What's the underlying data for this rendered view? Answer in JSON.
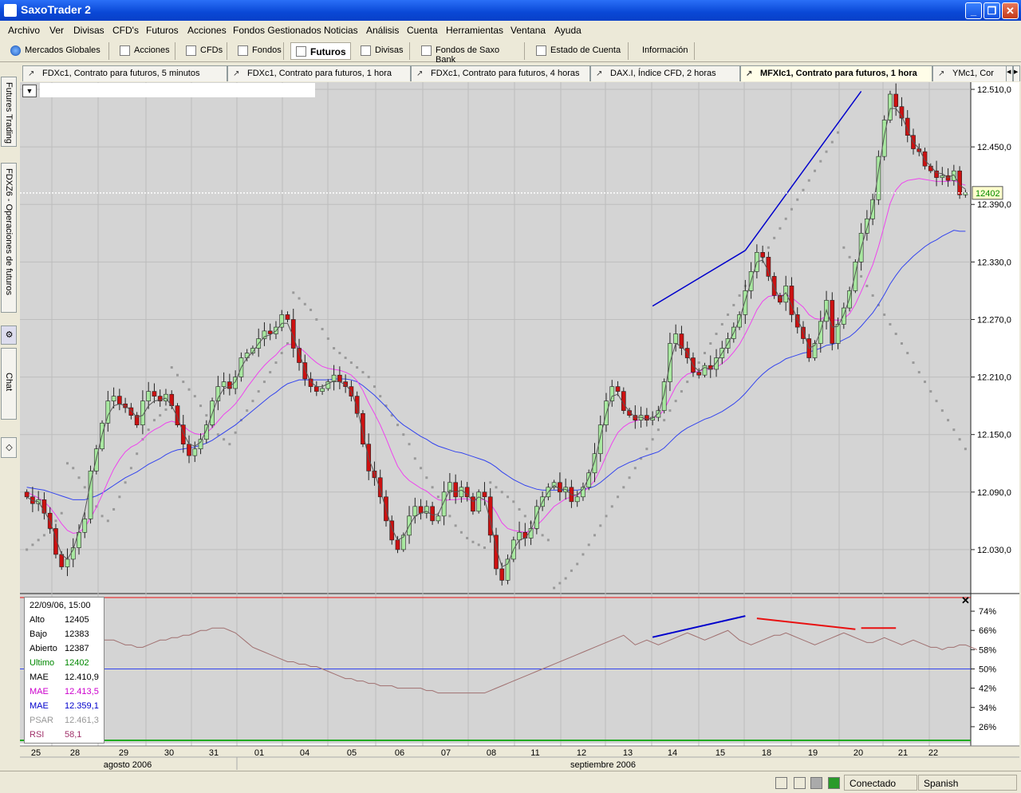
{
  "window": {
    "title": "SaxoTrader 2"
  },
  "menu": [
    "Archivo",
    "Ver",
    "Divisas",
    "CFD's",
    "Futuros",
    "Acciones",
    "Fondos Gestionados",
    "Noticias",
    "Análisis",
    "Cuenta",
    "Herramientas",
    "Ventana",
    "Ayuda"
  ],
  "toolbar": [
    {
      "label": "Mercados Globales",
      "icon": "globe-icon"
    },
    {
      "label": "Acciones",
      "icon": "stocks-icon"
    },
    {
      "label": "CFDs",
      "icon": "cfd-icon"
    },
    {
      "label": "Fondos",
      "icon": "funds-icon"
    },
    {
      "label": "Futuros",
      "icon": "futures-icon",
      "active": true
    },
    {
      "label": "Divisas",
      "icon": "fx-icon"
    },
    {
      "label": "Fondos de Saxo Bank",
      "icon": "saxo-funds-icon"
    },
    {
      "label": "Estado de Cuenta",
      "icon": "account-icon"
    },
    {
      "label": "Información",
      "icon": ""
    }
  ],
  "chart_tabs": [
    {
      "label": "FDXc1, Contrato para futuros, 5 minutos"
    },
    {
      "label": "FDXc1, Contrato para futuros, 1 hora"
    },
    {
      "label": "FDXc1, Contrato para futuros, 4 horas"
    },
    {
      "label": "DAX.I, Índice CFD, 2 horas"
    },
    {
      "label": "MFXIc1, Contrato para futuros, 1 hora",
      "active": true
    },
    {
      "label": "YMc1, Cor"
    }
  ],
  "side_tabs": [
    "Futures Trading",
    "FDXZ6 - Operaciones de futuros",
    "Chat"
  ],
  "colors": {
    "bull": "#a8e8a0",
    "bear": "#cc1111",
    "mae_fast": "#555555",
    "mae_mid": "#ee44ee",
    "mae_slow": "#3344ee",
    "psar": "#999999",
    "rsi": "#a07070",
    "trend": "#0000cc"
  },
  "chart_data": {
    "type": "candlestick",
    "price_axis": {
      "ticks": [
        "12.510,0",
        "12.450,0",
        "12.390,0",
        "12.330,0",
        "12.270,0",
        "12.210,0",
        "12.150,0",
        "12.090,0",
        "12.030,0"
      ],
      "ylim": [
        11985,
        12515
      ]
    },
    "current_price": "12402",
    "x_labels": [
      "25",
      "28",
      "29",
      "30",
      "31",
      "01",
      "04",
      "05",
      "06",
      "07",
      "08",
      "11",
      "12",
      "13",
      "14",
      "15",
      "18",
      "19",
      "20",
      "21",
      "22"
    ],
    "month_labels": [
      "agosto 2006",
      "septiembre 2006"
    ],
    "rsi_axis": {
      "ticks": [
        "74%",
        "66%",
        "58%",
        "50%",
        "42%",
        "34%",
        "26%"
      ],
      "ylim": [
        20,
        80
      ]
    },
    "closes": [
      12085,
      12078,
      12082,
      12068,
      12052,
      12025,
      12012,
      12020,
      12032,
      12048,
      12062,
      12112,
      12135,
      12162,
      12185,
      12190,
      12182,
      12178,
      12170,
      12160,
      12185,
      12195,
      12190,
      12185,
      12192,
      12180,
      12160,
      12140,
      12128,
      12135,
      12145,
      12160,
      12185,
      12200,
      12205,
      12198,
      12210,
      12230,
      12235,
      12240,
      12250,
      12258,
      12255,
      12262,
      12275,
      12270,
      12240,
      12225,
      12208,
      12200,
      12195,
      12198,
      12205,
      12212,
      12205,
      12200,
      12190,
      12172,
      12140,
      12112,
      12105,
      12085,
      12060,
      12040,
      12030,
      12045,
      12065,
      12075,
      12068,
      12075,
      12060,
      12065,
      12090,
      12100,
      12085,
      12095,
      12085,
      12070,
      12090,
      12085,
      12045,
      12010,
      11998,
      12020,
      12040,
      12048,
      12042,
      12052,
      12075,
      12085,
      12095,
      12100,
      12090,
      12095,
      12080,
      12085,
      12095,
      12110,
      12130,
      12160,
      12185,
      12200,
      12195,
      12175,
      12170,
      12165,
      12170,
      12165,
      12168,
      12175,
      12205,
      12245,
      12255,
      12240,
      12230,
      12215,
      12212,
      12222,
      12218,
      12230,
      12240,
      12250,
      12262,
      12275,
      12300,
      12320,
      12340,
      12335,
      12315,
      12295,
      12288,
      12305,
      12275,
      12262,
      12250,
      12230,
      12245,
      12268,
      12290,
      12245,
      12265,
      12282,
      12300,
      12330,
      12360,
      12375,
      12395,
      12440,
      12478,
      12505,
      12492,
      12480,
      12462,
      12448,
      12445,
      12430,
      12425,
      12418,
      12420,
      12415,
      12425,
      12400,
      12402
    ],
    "mae_fast": [
      12085,
      12081,
      12080,
      12070,
      12060,
      12042,
      12025,
      12020,
      12030,
      12050,
      12070,
      12100,
      12125,
      12150,
      12170,
      12180,
      12182,
      12180,
      12175,
      12168,
      12170,
      12180,
      12185,
      12186,
      12188,
      12180,
      12168,
      12152,
      12140,
      12138,
      12142,
      12155,
      12172,
      12188,
      12198,
      12200,
      12205,
      12220,
      12230,
      12236,
      12245,
      12252,
      12254,
      12258,
      12266,
      12266,
      12252,
      12235,
      12218,
      12205,
      12200,
      12200,
      12203,
      12206,
      12205,
      12202,
      12195,
      12178,
      12152,
      12125,
      12110,
      12092,
      12072,
      12052,
      12040,
      12043,
      12055,
      12065,
      12068,
      12070,
      12066,
      12067,
      12080,
      12092,
      12090,
      12092,
      12088,
      12080,
      12085,
      12082,
      12060,
      12032,
      12012,
      12015,
      12030,
      12040,
      12042,
      12050,
      12066,
      12080,
      12090,
      12097,
      12093,
      12093,
      12087,
      12087,
      12093,
      12105,
      12122,
      12148,
      12172,
      12190,
      12192,
      12182,
      12174,
      12168,
      12168,
      12166,
      12167,
      12172,
      12192,
      12225,
      12245,
      12242,
      12235,
      12222,
      12216,
      12220,
      12218,
      12225,
      12235,
      12245,
      12256,
      12270,
      12290,
      12310,
      12330,
      12332,
      12320,
      12303,
      12292,
      12298,
      12285,
      12270,
      12258,
      12240,
      12243,
      12258,
      12280,
      12262,
      12263,
      12275,
      12292,
      12318,
      12345,
      12365,
      12385,
      12425,
      12462,
      12490,
      12490,
      12482,
      12468,
      12455,
      12448,
      12436,
      12430,
      12423,
      12422,
      12418,
      12421,
      12410,
      12406
    ],
    "mae_mid": [
      12090,
      12087,
      12084,
      12080,
      12074,
      12066,
      12057,
      12050,
      12047,
      12048,
      12053,
      12063,
      12074,
      12087,
      12101,
      12114,
      12124,
      12132,
      12137,
      12140,
      12145,
      12151,
      12155,
      12158,
      12162,
      12164,
      12162,
      12159,
      12154,
      12151,
      12150,
      12152,
      12157,
      12164,
      12171,
      12176,
      12182,
      12190,
      12199,
      12207,
      12215,
      12222,
      12228,
      12233,
      12240,
      12244,
      12244,
      12241,
      12236,
      12230,
      12225,
      12221,
      12219,
      12218,
      12217,
      12215,
      12212,
      12206,
      12196,
      12183,
      12172,
      12160,
      12146,
      12131,
      12117,
      12108,
      12102,
      12098,
      12094,
      12091,
      12086,
      12082,
      12081,
      12082,
      12082,
      12083,
      12083,
      12081,
      12082,
      12082,
      12078,
      12069,
      12058,
      12052,
      12050,
      12049,
      12048,
      12050,
      12055,
      12061,
      12068,
      12075,
      12079,
      12083,
      12085,
      12087,
      12090,
      12095,
      12102,
      12114,
      12128,
      12141,
      12152,
      12158,
      12162,
      12164,
      12166,
      12167,
      12167,
      12169,
      12176,
      12188,
      12200,
      12208,
      12213,
      12215,
      12216,
      12218,
      12218,
      12220,
      12224,
      12229,
      12236,
      12244,
      12255,
      12267,
      12280,
      12289,
      12294,
      12295,
      12295,
      12296,
      12293,
      12288,
      12283,
      12275,
      12271,
      12270,
      12274,
      12270,
      12269,
      12271,
      12276,
      12286,
      12299,
      12313,
      12327,
      12346,
      12368,
      12391,
      12405,
      12412,
      12415,
      12416,
      12417,
      12416,
      12415,
      12414,
      12414,
      12414,
      12415,
      12412,
      12410
    ],
    "mae_slow": [
      12095,
      12094,
      12093,
      12092,
      12090,
      12088,
      12086,
      12084,
      12082,
      12082,
      12082,
      12084,
      12086,
      12089,
      12093,
      12097,
      12101,
      12105,
      12108,
      12111,
      12115,
      12119,
      12122,
      12125,
      12129,
      12132,
      12134,
      12135,
      12136,
      12137,
      12139,
      12141,
      12144,
      12148,
      12152,
      12156,
      12160,
      12165,
      12170,
      12175,
      12180,
      12185,
      12190,
      12194,
      12199,
      12203,
      12205,
      12207,
      12207,
      12207,
      12207,
      12207,
      12207,
      12208,
      12208,
      12208,
      12207,
      12205,
      12201,
      12196,
      12191,
      12185,
      12179,
      12172,
      12165,
      12160,
      12156,
      12152,
      12148,
      12145,
      12141,
      12138,
      12136,
      12134,
      12132,
      12131,
      12129,
      12127,
      12125,
      12123,
      12120,
      12116,
      12111,
      12107,
      12103,
      12100,
      12097,
      12095,
      12093,
      12092,
      12092,
      12092,
      12092,
      12092,
      12092,
      12092,
      12093,
      12094,
      12096,
      12100,
      12105,
      12110,
      12115,
      12118,
      12121,
      12123,
      12126,
      12128,
      12130,
      12132,
      12136,
      12142,
      12148,
      12153,
      12157,
      12160,
      12163,
      12166,
      12168,
      12171,
      12174,
      12178,
      12182,
      12187,
      12193,
      12200,
      12207,
      12213,
      12218,
      12222,
      12225,
      12229,
      12231,
      12233,
      12235,
      12236,
      12238,
      12240,
      12243,
      12244,
      12246,
      12249,
      12252,
      12257,
      12263,
      12270,
      12277,
      12286,
      12296,
      12307,
      12316,
      12324,
      12330,
      12336,
      12341,
      12346,
      12350,
      12353,
      12357,
      12360,
      12363,
      12362,
      12362
    ],
    "psar": [
      12030,
      12035,
      12040,
      12045,
      12052,
      12060,
      12068,
      12120,
      12115,
      12105,
      12095,
      12085,
      12075,
      12065,
      12060,
      12072,
      12085,
      12100,
      12115,
      12130,
      12145,
      12155,
      12165,
      12170,
      12176,
      12220,
      12212,
      12205,
      12197,
      12190,
      12180,
      12170,
      12160,
      12150,
      12145,
      12140,
      12152,
      12165,
      12175,
      12185,
      12195,
      12205,
      12215,
      12225,
      12235,
      12245,
      12298,
      12292,
      12286,
      12280,
      12270,
      12260,
      12250,
      12240,
      12235,
      12230,
      12225,
      12220,
      12215,
      12210,
      12200,
      12190,
      12180,
      12170,
      12160,
      12150,
      12140,
      12125,
      12115,
      12105,
      12095,
      12085,
      12075,
      12065,
      12055,
      12048,
      12042,
      12038,
      12035,
      12032,
      12100,
      12095,
      12090,
      12085,
      12080,
      12072,
      12065,
      12058,
      12052,
      12045,
      12040,
      11990,
      11995,
      12000,
      12008,
      12015,
      12025,
      12035,
      12045,
      12055,
      12065,
      12075,
      12085,
      12095,
      12105,
      12115,
      12125,
      12135,
      12145,
      12155,
      12165,
      12175,
      12185,
      12195,
      12205,
      12215,
      12225,
      12235,
      12245,
      12255,
      12265,
      12275,
      12285,
      12295,
      12305,
      12315,
      12325,
      12335,
      12345,
      12355,
      12365,
      12375,
      12385,
      12395,
      12405,
      12415,
      12425,
      12435,
      12445,
      12455,
      12465,
      12345,
      12335,
      12325,
      12315,
      12305,
      12295,
      12285,
      12275,
      12265,
      12255,
      12245,
      12235,
      12225,
      12215,
      12205,
      12195,
      12185,
      12175,
      12165,
      12155,
      12145,
      12135
    ],
    "rsi": [
      56,
      57,
      57,
      58,
      58,
      59,
      59,
      60,
      60,
      61,
      61,
      62,
      62,
      62,
      62,
      62,
      61,
      60,
      60,
      59,
      59,
      60,
      61,
      62,
      62,
      63,
      63,
      64,
      64,
      65,
      66,
      66,
      67,
      67,
      67,
      66,
      65,
      63,
      61,
      59,
      58,
      57,
      56,
      55,
      54,
      53,
      53,
      52,
      52,
      51,
      51,
      50,
      49,
      48,
      47,
      46,
      46,
      45,
      45,
      44,
      44,
      43,
      43,
      43,
      42,
      42,
      42,
      42,
      42,
      41,
      41,
      40,
      40,
      40,
      40,
      40,
      40,
      40,
      40,
      40,
      41,
      42,
      43,
      44,
      45,
      46,
      47,
      48,
      49,
      50,
      51,
      52,
      53,
      54,
      55,
      56,
      57,
      58,
      59,
      60,
      61,
      62,
      63,
      64,
      62,
      60,
      61,
      62,
      61,
      60,
      61,
      62,
      63,
      64,
      65,
      64,
      63,
      62,
      63,
      64,
      65,
      66,
      64,
      62,
      61,
      60,
      61,
      62,
      63,
      64,
      64,
      65,
      64,
      63,
      62,
      61,
      60,
      61,
      62,
      63,
      64,
      65,
      64,
      63,
      62,
      61,
      61,
      62,
      63,
      62,
      61,
      60,
      61,
      62,
      61,
      60,
      59,
      59,
      58,
      59,
      59,
      60,
      60,
      59,
      58
    ],
    "rsi_trend_lines": [
      {
        "color": "#0000cc",
        "from": [
          108,
          63.2
        ],
        "to": [
          124,
          72
        ]
      },
      {
        "color": "#e81010",
        "from": [
          126,
          71
        ],
        "to": [
          143,
          66.5
        ]
      },
      {
        "color": "#e81010",
        "from": [
          144,
          67
        ],
        "to": [
          150,
          67
        ]
      }
    ],
    "price_trend_lines": [
      {
        "from": [
          108,
          12284
        ],
        "to": [
          124,
          12342
        ]
      },
      {
        "from": [
          124,
          12342
        ],
        "to": [
          144,
          12508
        ]
      }
    ],
    "legend": {
      "date": "22/09/06, 15:00",
      "rows": [
        {
          "label": "Alto",
          "value": "12405",
          "color": "#000000"
        },
        {
          "label": "Bajo",
          "value": "12383",
          "color": "#000000"
        },
        {
          "label": "Abierto",
          "value": "12387",
          "color": "#000000"
        },
        {
          "label": "Ultimo",
          "value": "12402",
          "color": "#008800"
        },
        {
          "label": "MAE",
          "value": "12.410,9",
          "color": "#000000"
        },
        {
          "label": "MAE",
          "value": "12.413,5",
          "color": "#cc00cc"
        },
        {
          "label": "MAE",
          "value": "12.359,1",
          "color": "#0000cc"
        },
        {
          "label": "PSAR",
          "value": "12.461,3",
          "color": "#999999"
        },
        {
          "label": "RSI",
          "value": "58,1",
          "color": "#a0306a"
        }
      ]
    }
  },
  "status": {
    "connection": "Conectado",
    "language": "Spanish"
  }
}
